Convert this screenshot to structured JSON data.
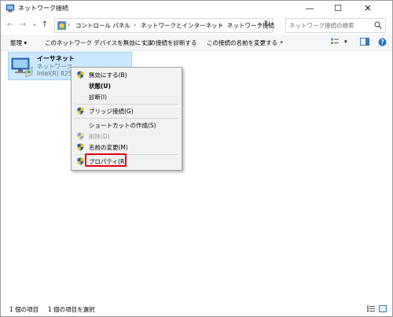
{
  "window": {
    "title": "ネットワーク接続",
    "controls": {
      "minimize": "—",
      "maximize": "☐",
      "close": "✕"
    }
  },
  "address": {
    "breadcrumbs": [
      "コントロール パネル",
      "ネットワークとインターネット",
      "ネットワーク接続"
    ],
    "search_placeholder": "ネットワーク接続の検索"
  },
  "commands": {
    "organize": "整理",
    "disable": "このネットワーク デバイスを無効にする",
    "diagnose": "この接続を診断する",
    "rename": "この接続の名前を変更する",
    "more": "»"
  },
  "connection": {
    "name": "イーサネット",
    "status": "ネットワーク",
    "adapter": "Intel(R) 8257"
  },
  "context_menu": {
    "items": [
      {
        "label": "無効にする(B)",
        "shield": true,
        "bold": false,
        "disabled": false
      },
      {
        "label": "状態(U)",
        "shield": false,
        "bold": true,
        "disabled": false
      },
      {
        "label": "診断(I)",
        "shield": false,
        "bold": false,
        "disabled": false
      },
      {
        "label": "ブリッジ接続(G)",
        "shield": true,
        "bold": false,
        "disabled": false
      },
      {
        "label": "ショートカットの作成(S)",
        "shield": false,
        "bold": false,
        "disabled": false
      },
      {
        "label": "削除(D)",
        "shield": true,
        "bold": false,
        "disabled": true
      },
      {
        "label": "名前の変更(M)",
        "shield": true,
        "bold": false,
        "disabled": false
      },
      {
        "label": "プロパティ(R)",
        "shield": true,
        "bold": false,
        "disabled": false
      }
    ],
    "highlight_color": "#e60012"
  },
  "status": {
    "item_count": "1 個の項目",
    "selected": "1 個の項目を選択"
  },
  "colors": {
    "selection_bg": "#cce8ff",
    "selection_border": "#99d1ff",
    "menu_bg": "#f2f2f2",
    "highlight": "#e60012"
  }
}
